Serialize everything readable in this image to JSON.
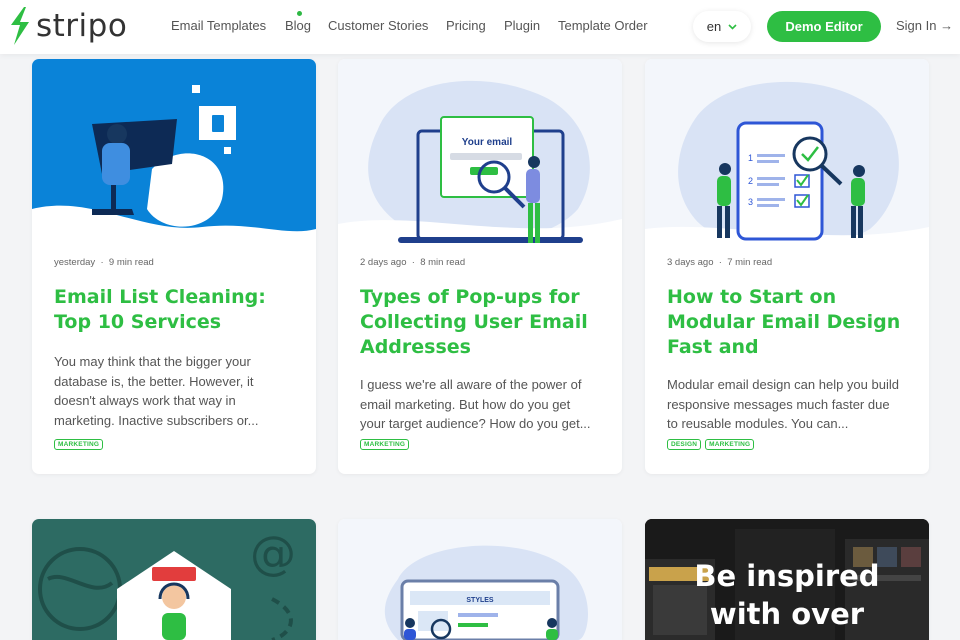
{
  "header": {
    "logo_text": "stripo",
    "nav": [
      "Email Templates",
      "Blog",
      "Customer Stories",
      "Pricing",
      "Plugin",
      "Template Order"
    ],
    "language": "en",
    "demo_button": "Demo Editor",
    "sign_in": "Sign In →"
  },
  "cards": [
    {
      "date": "yesterday",
      "read_time": "9 min read",
      "title": "Email List Cleaning: Top 10 Services",
      "excerpt": "You may think that the bigger your database is, the better. However, it doesn't always work that way in marketing. Inactive subscribers or...",
      "tags": [
        "MARKETING"
      ]
    },
    {
      "date": "2 days ago",
      "read_time": "8 min read",
      "title": "Types of Pop-ups for Collecting User Email Addresses",
      "excerpt": "I guess we're all aware of the power of email marketing. But how do you get your target audience? How do you get...",
      "tags": [
        "MARKETING"
      ],
      "illustration_text": "Your email"
    },
    {
      "date": "3 days ago",
      "read_time": "7 min read",
      "title": "How to Start on Modular Email Design Fast and",
      "excerpt": "Modular email design can help you build responsive messages much faster due to reusable modules. You can...",
      "tags": [
        "DESIGN",
        "MARKETING"
      ]
    },
    {
      "illustration": "email-support"
    },
    {
      "illustration_text": "STYLES"
    },
    {
      "promo_text": "Be inspired with over"
    }
  ],
  "colors": {
    "brand_green": "#2ebe43",
    "blue": "#0a7fd4",
    "nav_text": "#555555"
  }
}
